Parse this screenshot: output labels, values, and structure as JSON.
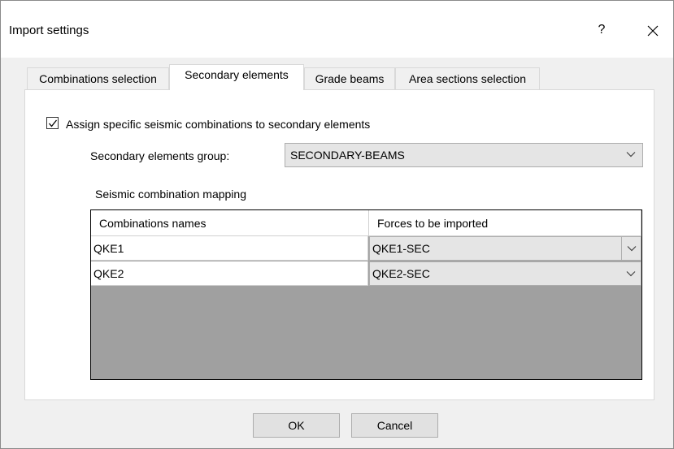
{
  "window": {
    "title": "Import settings",
    "help_glyph": "?",
    "close_glyph": "✕"
  },
  "tabs": [
    {
      "label": "Combinations selection",
      "active": false
    },
    {
      "label": "Secondary elements",
      "active": true
    },
    {
      "label": "Grade beams",
      "active": false
    },
    {
      "label": "Area sections selection",
      "active": false
    }
  ],
  "secondary": {
    "assign_checkbox": {
      "label": "Assign specific seismic combinations to secondary elements",
      "checked": true
    },
    "group_label": "Secondary elements group:",
    "group_value": "SECONDARY-BEAMS",
    "mapping_label": "Seismic combination mapping"
  },
  "grid": {
    "headers": [
      "Combinations names",
      "Forces to be imported"
    ],
    "rows": [
      {
        "name": "QKE1",
        "force": "QKE1-SEC"
      },
      {
        "name": "QKE2",
        "force": "QKE2-SEC"
      }
    ]
  },
  "buttons": {
    "ok": "OK",
    "cancel": "Cancel"
  },
  "colors": {
    "panel": "#ffffff",
    "window": "#f0f0f0",
    "grid_empty": "#a0a0a0",
    "combo": "#e5e5e5"
  }
}
